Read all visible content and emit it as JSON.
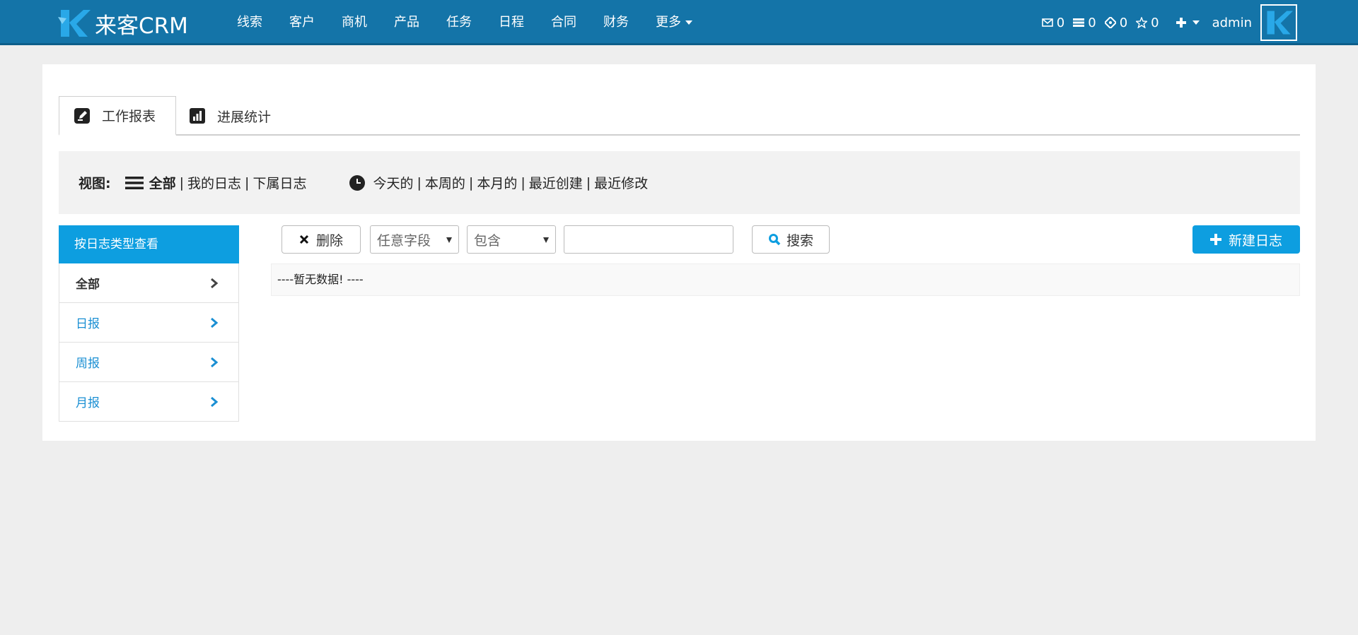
{
  "app": {
    "logo_text": "来客CRM"
  },
  "nav": {
    "items": [
      "线索",
      "客户",
      "商机",
      "产品",
      "任务",
      "日程",
      "合同",
      "财务"
    ],
    "more_label": "更多"
  },
  "header_right": {
    "mail_count": "0",
    "task_count": "0",
    "event_count": "0",
    "fav_count": "0",
    "user": "admin"
  },
  "tabs": {
    "work_report": "工作报表",
    "progress_stats": "进展统计"
  },
  "view": {
    "label": "视图:",
    "all": "全部",
    "mine": "我的日志",
    "subordinate": "下属日志",
    "today": "今天的",
    "this_week": "本周的",
    "this_month": "本月的",
    "recent_created": "最近创建",
    "recent_modified": "最近修改",
    "sep": "|"
  },
  "sidebar": {
    "header": "按日志类型查看",
    "items": [
      {
        "label": "全部"
      },
      {
        "label": "日报"
      },
      {
        "label": "周报"
      },
      {
        "label": "月报"
      }
    ]
  },
  "toolbar": {
    "delete_label": "删除",
    "field_select": "任意字段",
    "op_select": "包含",
    "search_value": "",
    "search_label": "搜索",
    "new_label": "新建日志"
  },
  "table": {
    "empty_text": "----暂无数据! ----"
  },
  "colors": {
    "navbar": "#1474a8",
    "accent": "#0d9ee0",
    "link": "#1a8fd3"
  }
}
